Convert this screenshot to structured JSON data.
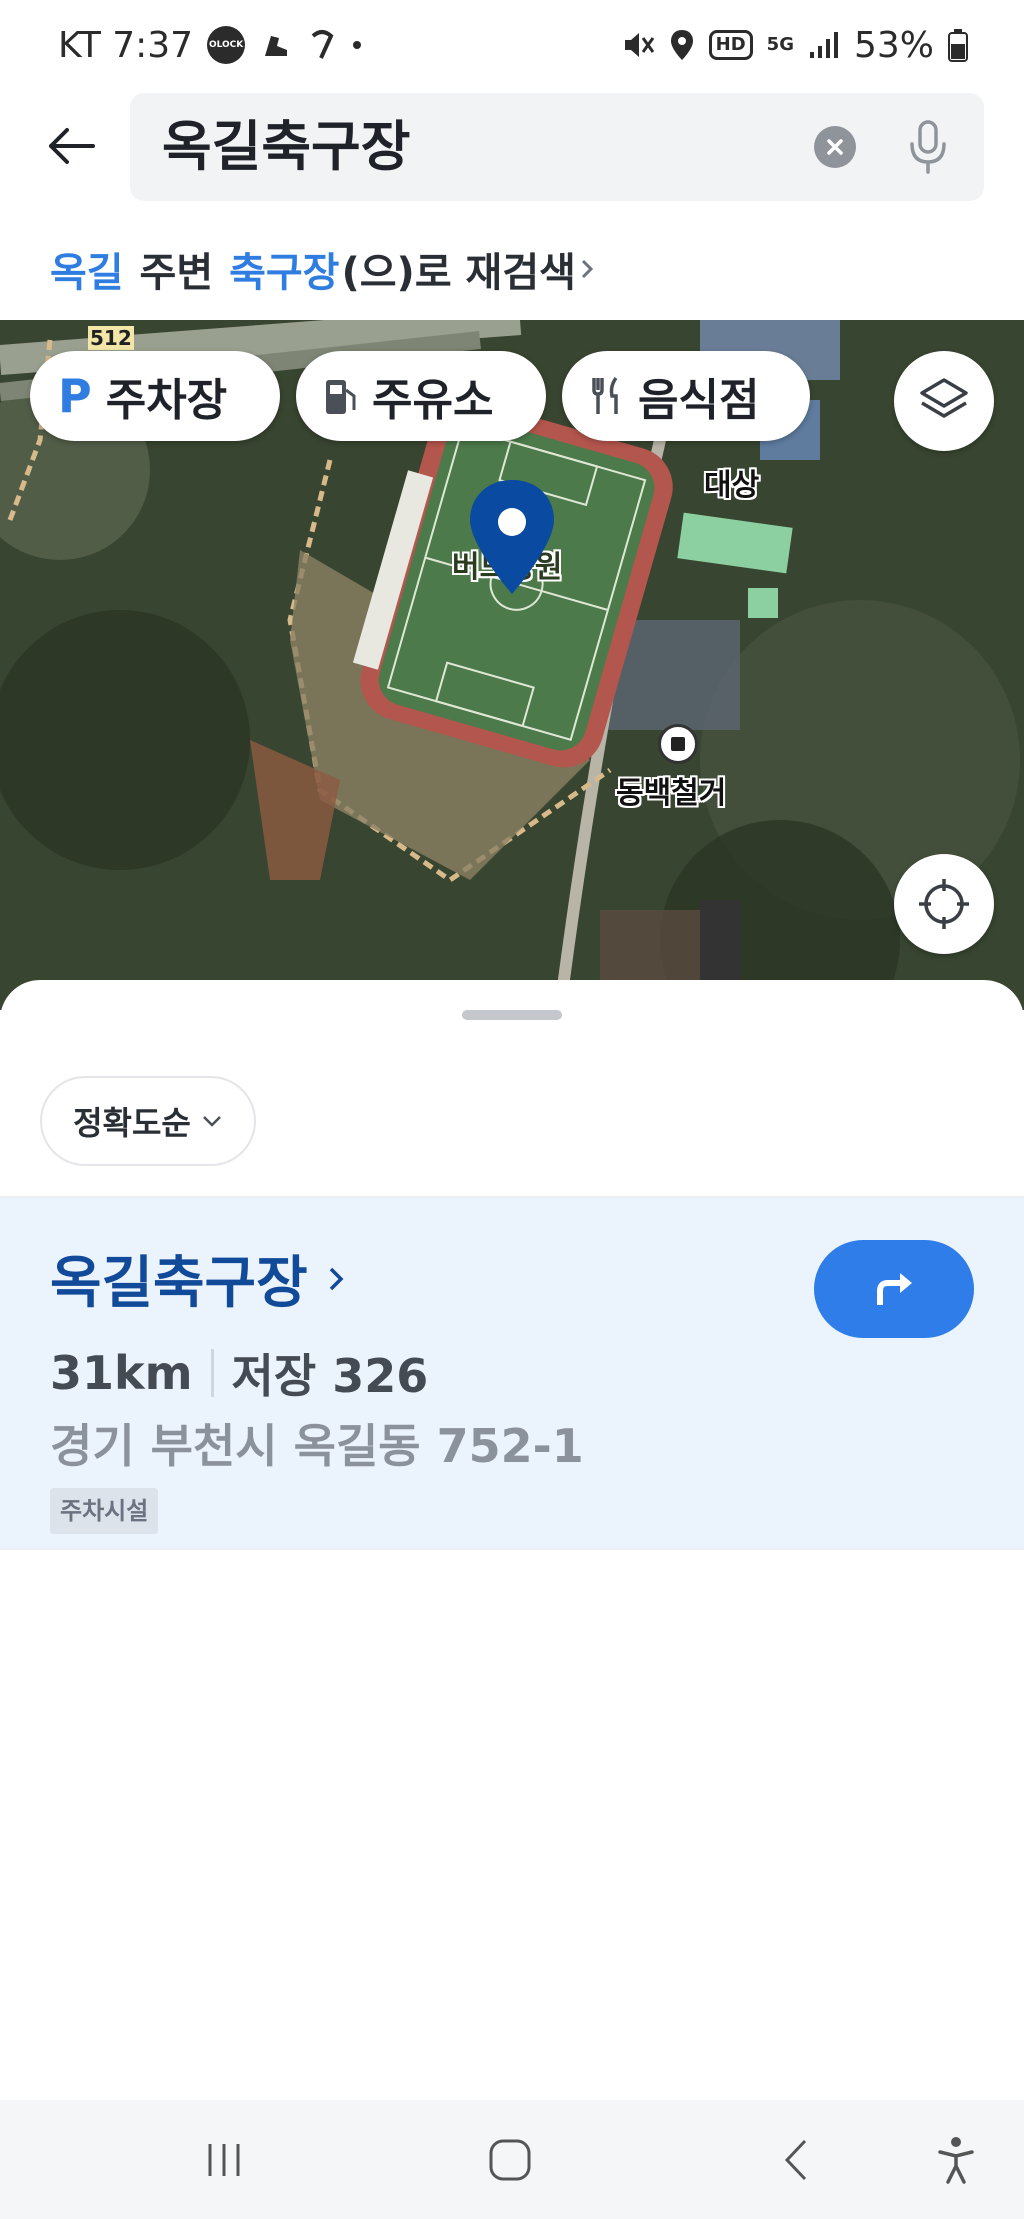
{
  "status_bar": {
    "carrier_time": "KT 7:37",
    "olock_label": "OLOCK",
    "hd_label": "HD",
    "network_label": "5G",
    "battery": "53%"
  },
  "search": {
    "query": "옥길축구장",
    "research_prefix": "옥길",
    "research_mid": " 주변 ",
    "research_keyword": "축구장",
    "research_suffix": "(으)로 재검색"
  },
  "map": {
    "filters": [
      {
        "icon": "parking-icon",
        "label": "주차장",
        "icon_letter": "P"
      },
      {
        "icon": "gas-station-icon",
        "label": "주유소"
      },
      {
        "icon": "restaurant-icon",
        "label": "음식점"
      }
    ],
    "labels": {
      "pin_label": "버드공원",
      "daesang": "대상",
      "dongbaek": "동백철거",
      "road_number": "512"
    }
  },
  "sheet": {
    "sort_label": "정확도순",
    "result": {
      "title": "옥길축구장",
      "distance": "31km",
      "reviews": "저장 326",
      "address": "경기 부천시 옥길동 752-1",
      "tag": "주차시설"
    }
  },
  "colors": {
    "accent": "#2f7de1",
    "title_blue": "#114a99",
    "result_bg": "#ebf3fd",
    "route_button": "#2f7de8",
    "pin": "#0a4aa0"
  }
}
